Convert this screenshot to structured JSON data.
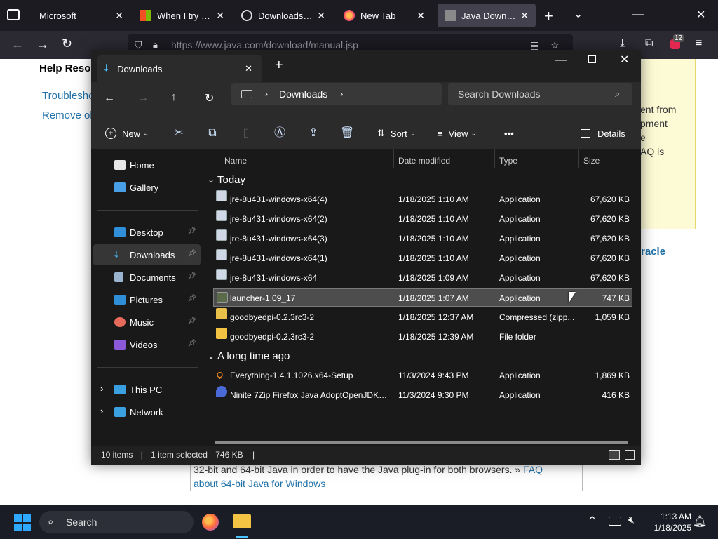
{
  "browser": {
    "tabs": [
      {
        "label": "Microsoft",
        "active": false
      },
      {
        "label": "When I try to ac",
        "active": false
      },
      {
        "label": "Downloads - Be",
        "active": false
      },
      {
        "label": "New Tab",
        "active": false
      },
      {
        "label": "Java Downloads",
        "active": true
      }
    ],
    "url": "https://www.java.com/download/manual.jsp",
    "badge_count": "12"
  },
  "webpage": {
    "heading": "Help Reso",
    "links": [
      "Troublesho",
      "Remove ol"
    ],
    "note_lines": [
      "ent from",
      "pment",
      "e",
      "AQ is"
    ],
    "oracle_link": "racle",
    "faq_text": "32-bit and 64-bit Java in order to have the Java plug-in for both browsers. »",
    "faq_link_1": "FAQ",
    "faq_link_2": "about 64-bit Java for Windows"
  },
  "explorer": {
    "tab_title": "Downloads",
    "address": [
      "Downloads"
    ],
    "search_placeholder": "Search Downloads",
    "commands": {
      "new": "New",
      "sort": "Sort",
      "view": "View",
      "more": "•••",
      "details": "Details"
    },
    "nav": {
      "home": "Home",
      "gallery": "Gallery",
      "desktop": "Desktop",
      "downloads": "Downloads",
      "documents": "Documents",
      "pictures": "Pictures",
      "music": "Music",
      "videos": "Videos",
      "thispc": "This PC",
      "network": "Network"
    },
    "columns": {
      "name": "Name",
      "date": "Date modified",
      "type": "Type",
      "size": "Size"
    },
    "groups": [
      "Today",
      "A long time ago"
    ],
    "files_today": [
      {
        "name": "jre-8u431-windows-x64(4)",
        "date": "1/18/2025 1:10 AM",
        "type": "Application",
        "size": "67,620 KB"
      },
      {
        "name": "jre-8u431-windows-x64(2)",
        "date": "1/18/2025 1:10 AM",
        "type": "Application",
        "size": "67,620 KB"
      },
      {
        "name": "jre-8u431-windows-x64(3)",
        "date": "1/18/2025 1:10 AM",
        "type": "Application",
        "size": "67,620 KB"
      },
      {
        "name": "jre-8u431-windows-x64(1)",
        "date": "1/18/2025 1:10 AM",
        "type": "Application",
        "size": "67,620 KB"
      },
      {
        "name": "jre-8u431-windows-x64",
        "date": "1/18/2025 1:09 AM",
        "type": "Application",
        "size": "67,620 KB"
      },
      {
        "name": "launcher-1.09_17",
        "date": "1/18/2025 1:07 AM",
        "type": "Application",
        "size": "747 KB"
      },
      {
        "name": "goodbyedpi-0.2.3rc3-2",
        "date": "1/18/2025 12:37 AM",
        "type": "Compressed (zipp...",
        "size": "1,059 KB"
      },
      {
        "name": "goodbyedpi-0.2.3rc3-2",
        "date": "1/18/2025 12:39 AM",
        "type": "File folder",
        "size": ""
      }
    ],
    "files_old": [
      {
        "name": "Everything-1.4.1.1026.x64-Setup",
        "date": "11/3/2024 9:43 PM",
        "type": "Application",
        "size": "1,869 KB"
      },
      {
        "name": "Ninite 7Zip Firefox Java AdoptOpenJDK x...",
        "date": "11/3/2024 9:30 PM",
        "type": "Application",
        "size": "416 KB"
      }
    ],
    "status": {
      "count": "10 items",
      "selected": "1 item selected",
      "size": "746 KB"
    }
  },
  "taskbar": {
    "search_label": "Search",
    "time": "1:13 AM",
    "date": "1/18/2025"
  }
}
